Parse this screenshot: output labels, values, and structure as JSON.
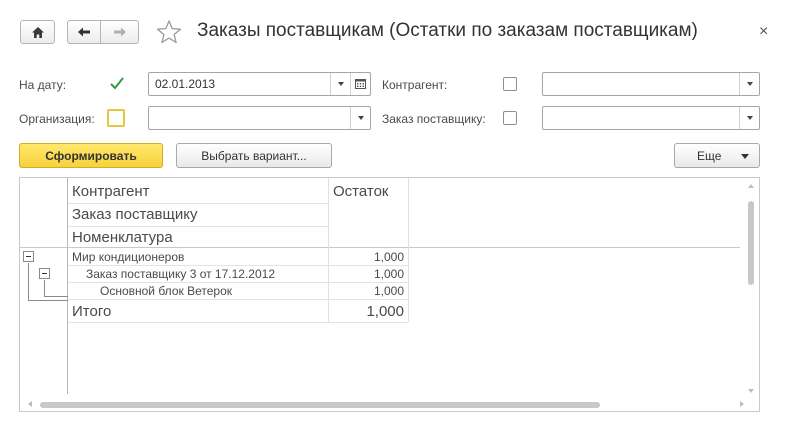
{
  "window": {
    "title": "Заказы поставщикам (Остатки по заказам поставщикам)",
    "close_glyph": "×"
  },
  "form": {
    "date_label": "На дату:",
    "date_value": "02.01.2013",
    "date_checked": true,
    "contractor_label": "Контрагент:",
    "contractor_value": "",
    "org_label": "Организация:",
    "org_value": "",
    "order_label": "Заказ поставщику:",
    "order_value": ""
  },
  "toolbar": {
    "generate_label": "Сформировать",
    "variant_label": "Выбрать вариант...",
    "more_label": "Еще"
  },
  "report": {
    "headers": {
      "contractor": "Контрагент",
      "balance": "Остаток",
      "supplier_order": "Заказ поставщику",
      "nomenclature": "Номенклатура"
    },
    "rows": [
      {
        "name": "Мир кондиционеров",
        "value": "1,000"
      },
      {
        "name": "Заказ поставщику 3 от 17.12.2012",
        "value": "1,000"
      },
      {
        "name": "Основной блок Ветерок",
        "value": "1,000"
      }
    ],
    "total": {
      "label": "Итого",
      "value": "1,000"
    }
  },
  "icons": {
    "home": "home-icon",
    "back": "arrow-left-icon",
    "forward": "arrow-right-icon",
    "favorite": "star-icon",
    "calendar": "calendar-icon"
  },
  "colors": {
    "primary_button": "#f7d23a",
    "checkmark": "#2e9c3a",
    "highlight_border": "#e8c545"
  }
}
